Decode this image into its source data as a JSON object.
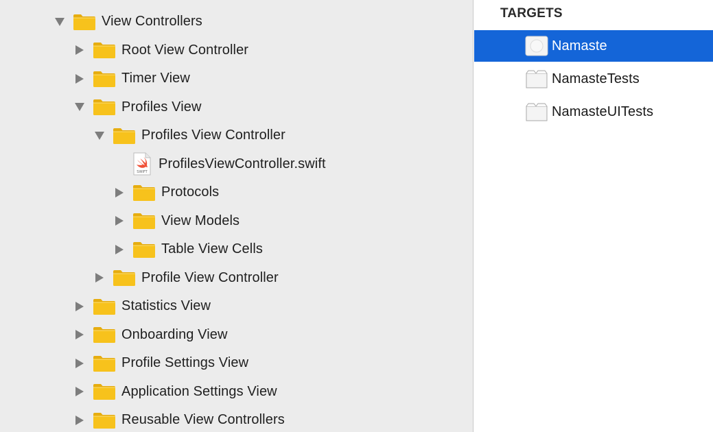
{
  "navigator": {
    "rows": [
      {
        "label": "View Controllers",
        "type": "folder",
        "expanded": true,
        "depth": 0
      },
      {
        "label": "Root View Controller",
        "type": "folder",
        "expanded": false,
        "depth": 1
      },
      {
        "label": "Timer View",
        "type": "folder",
        "expanded": false,
        "depth": 1
      },
      {
        "label": "Profiles View",
        "type": "folder",
        "expanded": true,
        "depth": 1
      },
      {
        "label": "Profiles View Controller",
        "type": "folder",
        "expanded": true,
        "depth": 2
      },
      {
        "label": "ProfilesViewController.swift",
        "type": "swift-file",
        "depth": 3
      },
      {
        "label": "Protocols",
        "type": "folder",
        "expanded": false,
        "depth": 3
      },
      {
        "label": "View Models",
        "type": "folder",
        "expanded": false,
        "depth": 3
      },
      {
        "label": "Table View Cells",
        "type": "folder",
        "expanded": false,
        "depth": 3
      },
      {
        "label": "Profile View Controller",
        "type": "folder",
        "expanded": false,
        "depth": 2
      },
      {
        "label": "Statistics View",
        "type": "folder",
        "expanded": false,
        "depth": 1
      },
      {
        "label": "Onboarding View",
        "type": "folder",
        "expanded": false,
        "depth": 1
      },
      {
        "label": "Profile Settings View",
        "type": "folder",
        "expanded": false,
        "depth": 1
      },
      {
        "label": "Application Settings View",
        "type": "folder",
        "expanded": false,
        "depth": 1
      },
      {
        "label": "Reusable View Controllers",
        "type": "folder",
        "expanded": false,
        "depth": 1
      }
    ]
  },
  "targets": {
    "heading": "TARGETS",
    "items": [
      {
        "label": "Namaste",
        "icon": "app-target-icon",
        "selected": true
      },
      {
        "label": "NamasteTests",
        "icon": "test-bundle-icon",
        "selected": false
      },
      {
        "label": "NamasteUITests",
        "icon": "test-bundle-icon",
        "selected": false
      }
    ]
  },
  "colors": {
    "selection": "#1465d8",
    "folder": "#f7c21c",
    "navigator_background": "#ececec",
    "swift_orange": "#f05138"
  }
}
